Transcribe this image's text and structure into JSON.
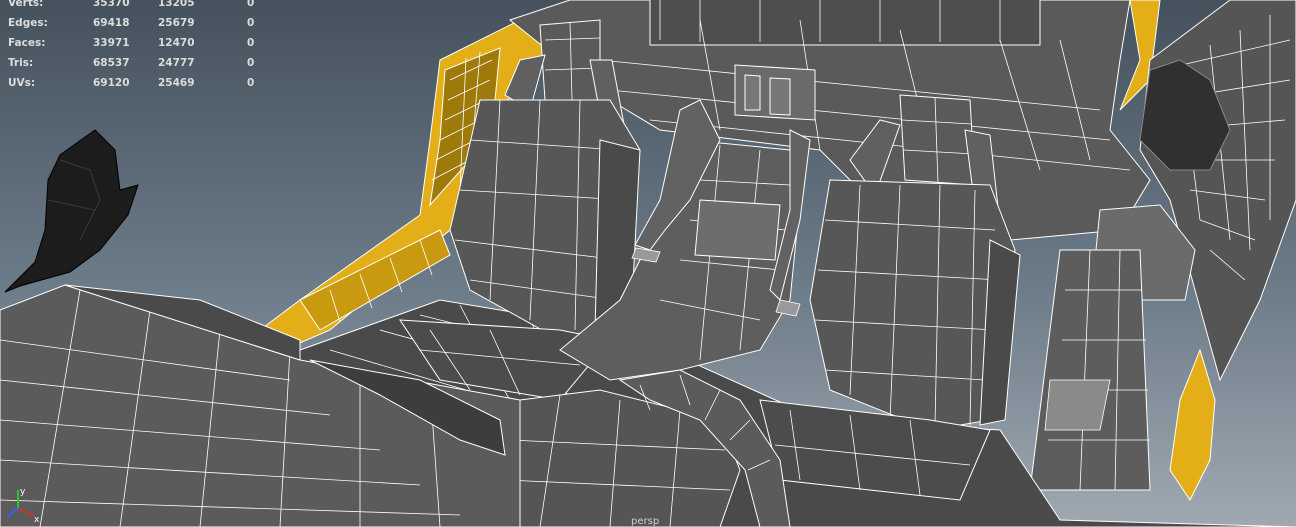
{
  "hud": {
    "rows": [
      {
        "label": "Verts:",
        "v1": "35370",
        "v2": "13205",
        "v3": "0"
      },
      {
        "label": "Edges:",
        "v1": "69418",
        "v2": "25679",
        "v3": "0"
      },
      {
        "label": "Faces:",
        "v1": "33971",
        "v2": "12470",
        "v3": "0"
      },
      {
        "label": "Tris:",
        "v1": "68537",
        "v2": "24777",
        "v3": "0"
      },
      {
        "label": "UVs:",
        "v1": "69120",
        "v2": "25469",
        "v3": "0"
      }
    ]
  },
  "axis": {
    "x_label": "x",
    "y_label": "y"
  },
  "camera": {
    "name": "persp"
  },
  "colors": {
    "background_top": "#4a5966",
    "background_bottom": "#9aa4ac",
    "mesh_gray": "#5c5c5c",
    "mesh_dark": "#3e3e3e",
    "mesh_light": "#7a7a7a",
    "wire": "#ffffff",
    "body_yellow": "#e8b417",
    "yellow_dark": "#b08400",
    "axis_x": "#d03030",
    "axis_y": "#30c030",
    "axis_z": "#3060ff"
  }
}
